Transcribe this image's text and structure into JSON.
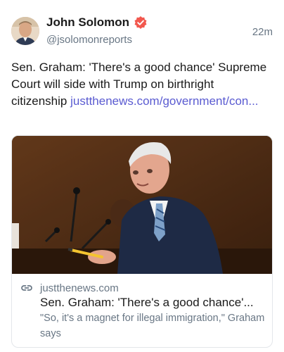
{
  "post": {
    "author": {
      "name": "John Solomon",
      "handle": "@jsolomonreports",
      "verified": true
    },
    "timestamp": "22m",
    "text": "Sen. Graham: 'There's a good chance' Supreme Court will side with Trump on birthright citizenship ",
    "link_text": "justthenews.com/government/con...",
    "link_color": "#5a5bd1"
  },
  "card": {
    "domain": "justthenews.com",
    "title": "Sen. Graham: 'There's a good chance'...",
    "description": "\"So, it's a magnet for illegal immigration,\" Graham says"
  },
  "colors": {
    "verified_badge": "#f2584e",
    "secondary_text": "#687684"
  }
}
